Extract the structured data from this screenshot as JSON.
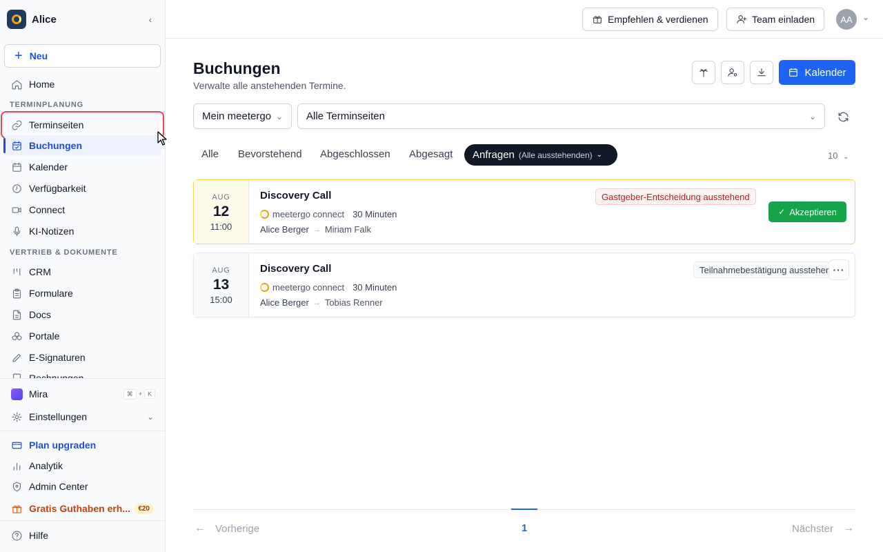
{
  "workspace": {
    "name": "Alice"
  },
  "sidebar": {
    "new_label": "Neu",
    "home_label": "Home",
    "section_scheduling": "TERMINPLANUNG",
    "section_sales": "VERTRIEB & DOKUMENTE",
    "items": [
      {
        "label": "Terminseiten",
        "icon": "link-icon"
      },
      {
        "label": "Buchungen",
        "icon": "calendar-check-icon",
        "active": true
      },
      {
        "label": "Kalender",
        "icon": "calendar-icon"
      },
      {
        "label": "Verfügbarkeit",
        "icon": "clock-icon"
      },
      {
        "label": "Connect",
        "icon": "video-icon"
      },
      {
        "label": "KI-Notizen",
        "icon": "mic-icon"
      }
    ],
    "sales_items": [
      {
        "label": "CRM",
        "icon": "kanban-icon"
      },
      {
        "label": "Formulare",
        "icon": "clipboard-icon"
      },
      {
        "label": "Docs",
        "icon": "document-icon"
      },
      {
        "label": "Portale",
        "icon": "portal-icon"
      },
      {
        "label": "E-Signaturen",
        "icon": "pen-icon"
      },
      {
        "label": "Rechnungen",
        "icon": "invoice-icon"
      }
    ],
    "mira_label": "Mira",
    "mira_shortcut": [
      "⌘",
      "+",
      "K"
    ],
    "settings_label": "Einstellungen",
    "upgrade_label": "Plan upgraden",
    "analytics_label": "Analytik",
    "admin_label": "Admin Center",
    "credit_label": "Gratis Guthaben erh...",
    "credit_badge": "€20",
    "help_label": "Hilfe"
  },
  "topbar": {
    "refer_label": "Empfehlen & verdienen",
    "invite_label": "Team einladen",
    "avatar_initials": "AA"
  },
  "page": {
    "title": "Buchungen",
    "subtitle": "Verwalte alle anstehenden Termine.",
    "calendar_button": "Kalender",
    "filter_owner": "Mein meetergo",
    "filter_pages": "Alle Terminseiten",
    "tabs": [
      "Alle",
      "Bevorstehend",
      "Abgeschlossen",
      "Abgesagt"
    ],
    "active_tab": "Anfragen",
    "active_tab_sub": "(Alle ausstehenden)",
    "per_page": "10"
  },
  "bookings": [
    {
      "month": "AUG",
      "day": "12",
      "time": "11:00",
      "title": "Discovery Call",
      "platform": "meetergo connect",
      "duration": "30 Minuten",
      "host": "Alice Berger",
      "guest": "Miriam Falk",
      "status": "Gastgeber-Entscheidung ausstehend",
      "action": "Akzeptieren"
    },
    {
      "month": "AUG",
      "day": "13",
      "time": "15:00",
      "title": "Discovery Call",
      "platform": "meetergo connect",
      "duration": "30 Minuten",
      "host": "Alice Berger",
      "guest": "Tobias Renner",
      "status": "Teilnahmebestätigung ausstehend"
    }
  ],
  "pagination": {
    "prev": "Vorherige",
    "current": "1",
    "next": "Nächster"
  },
  "colors": {
    "accent": "#1d64f2",
    "success": "#16a34a",
    "danger": "#b91c1c",
    "highlight": "#e5484d"
  }
}
